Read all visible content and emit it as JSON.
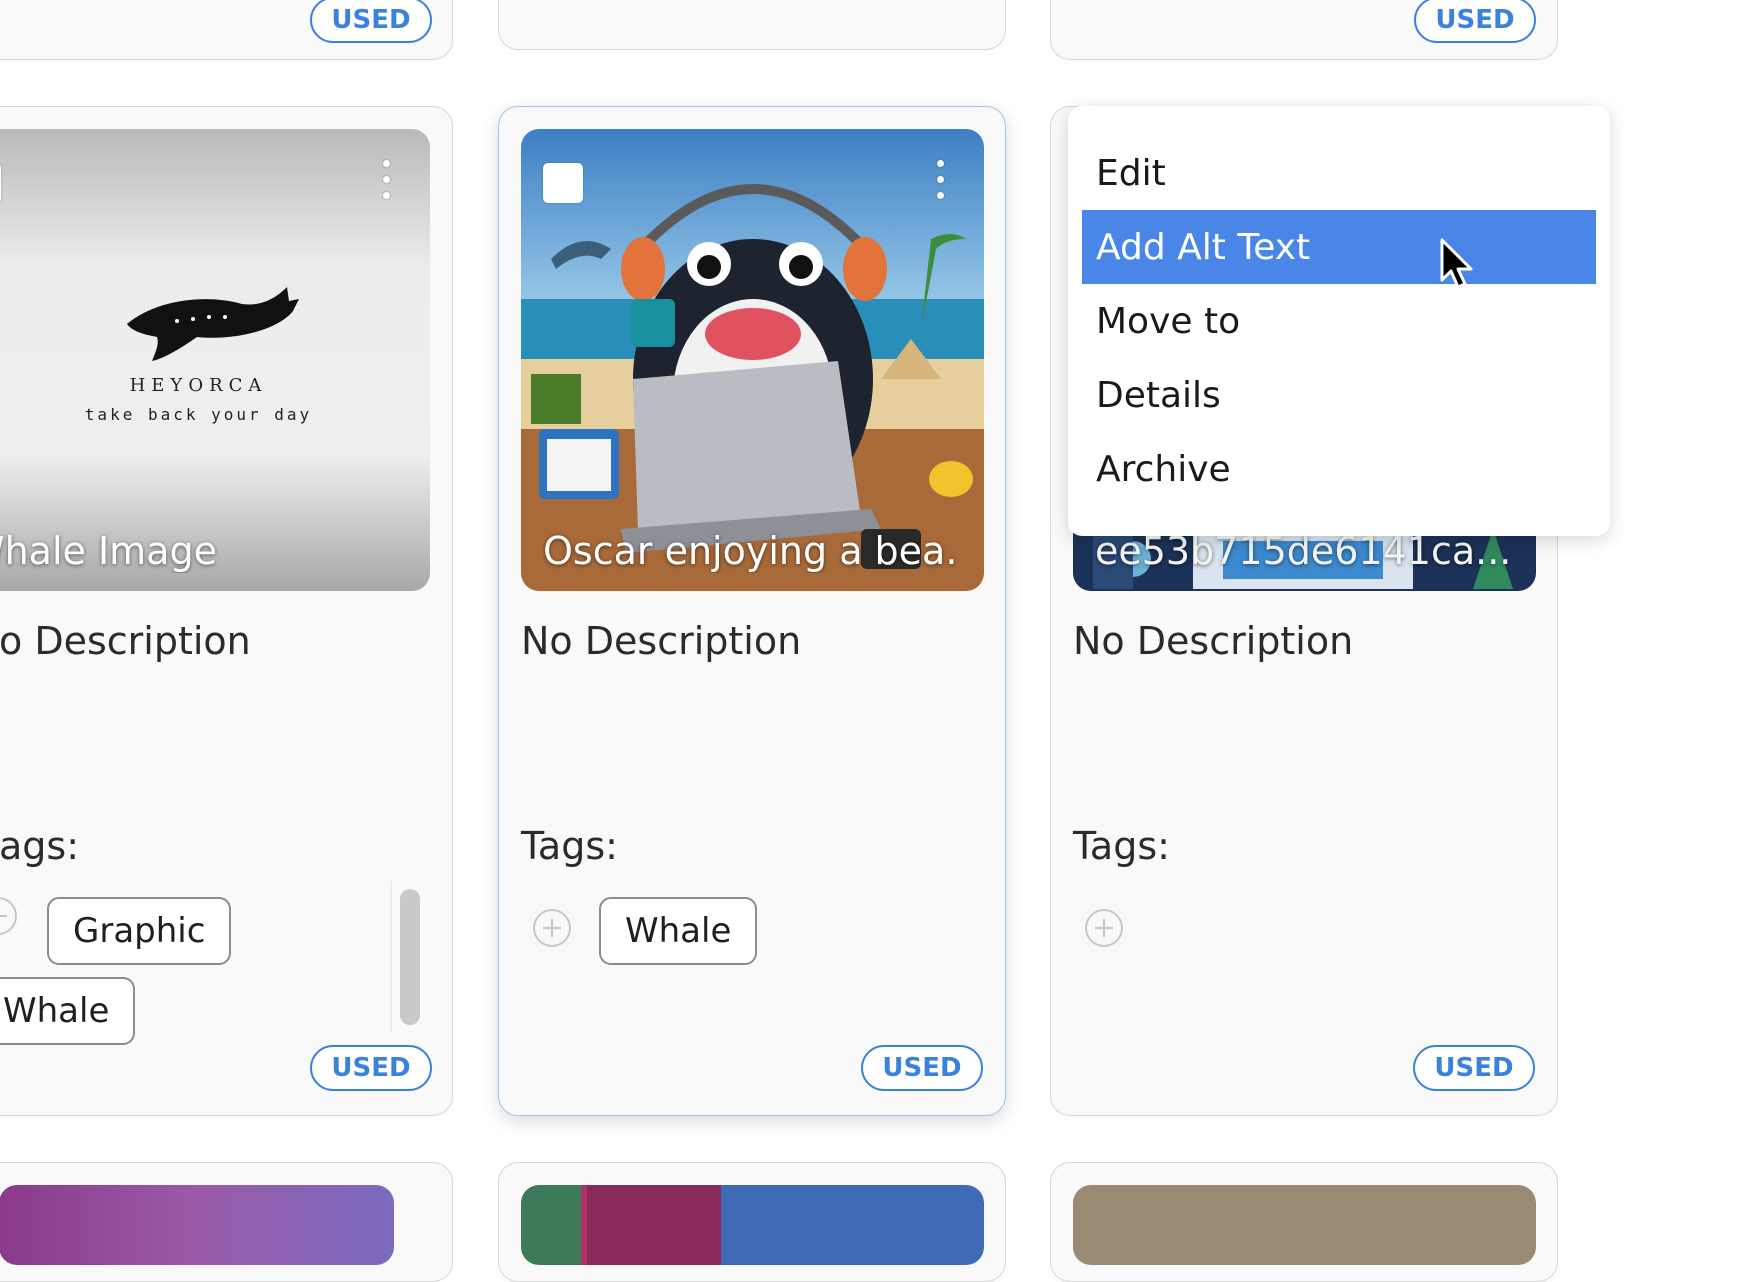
{
  "badges": {
    "used": "USED"
  },
  "cards": [
    {
      "id": "whale-logo",
      "caption": "Whale Image",
      "logo_brand": "HEYORCA",
      "logo_tagline": "take back your day",
      "description": "o Description",
      "tags_label": "ags:",
      "tags": [
        "Graphic",
        "Whale"
      ]
    },
    {
      "id": "oscar",
      "caption": "Oscar enjoying a bea...",
      "description": "No Description",
      "tags_label": "Tags:",
      "tags": [
        "Whale"
      ]
    },
    {
      "id": "hash-image",
      "caption": "ee53b715de6141ca...",
      "description": "No Description",
      "tags_label": "Tags:",
      "tags": []
    }
  ],
  "context_menu": {
    "items": [
      "Edit",
      "Add Alt Text",
      "Move to",
      "Details",
      "Archive"
    ],
    "active_item": "Add Alt Text"
  },
  "colors": {
    "accent": "#3b82dc",
    "menu_highlight": "#4a86e8",
    "card_border": "#d6d6d6"
  }
}
